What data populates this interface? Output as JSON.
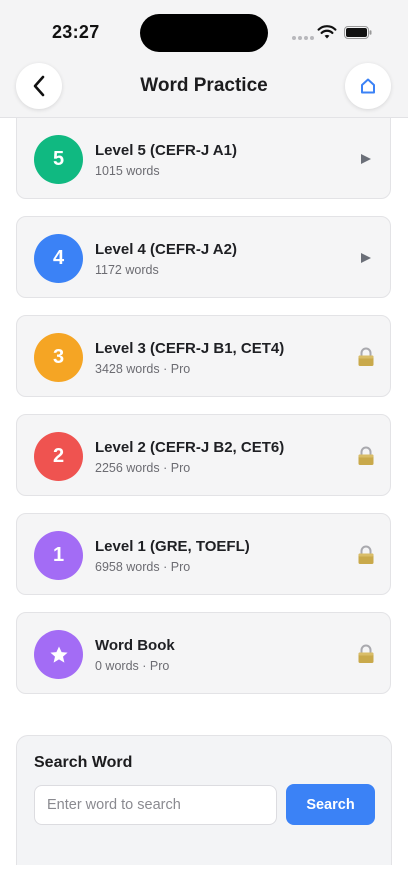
{
  "status_bar": {
    "time": "23:27"
  },
  "header": {
    "title": "Word Practice",
    "back_icon": "chevron-left-icon",
    "home_icon": "home-icon"
  },
  "colors": {
    "accent": "#3b82f6",
    "level5": "#10b981",
    "level4": "#3b82f6",
    "level3": "#f5a524",
    "level2": "#ef5350",
    "level1": "#a36cf5",
    "wordbook": "#a36cf5"
  },
  "levels": [
    {
      "badge": "5",
      "title": "Level 5 (CEFR-J A1)",
      "subtitle": "1015 words",
      "action_icon": "play-icon",
      "locked": false
    },
    {
      "badge": "4",
      "title": "Level 4 (CEFR-J A2)",
      "subtitle": "1172 words",
      "action_icon": "play-icon",
      "locked": false
    },
    {
      "badge": "3",
      "title": "Level 3 (CEFR-J B1, CET4)",
      "subtitle": "3428 words · Pro",
      "action_icon": "lock-icon",
      "locked": true
    },
    {
      "badge": "2",
      "title": "Level 2 (CEFR-J B2, CET6)",
      "subtitle": "2256 words · Pro",
      "action_icon": "lock-icon",
      "locked": true
    },
    {
      "badge": "1",
      "title": "Level 1 (GRE, TOEFL)",
      "subtitle": "6958 words · Pro",
      "action_icon": "lock-icon",
      "locked": true
    },
    {
      "badge_icon": "star-icon",
      "title": "Word Book",
      "subtitle": "0 words · Pro",
      "action_icon": "lock-icon",
      "locked": true
    }
  ],
  "search": {
    "title": "Search Word",
    "placeholder": "Enter word to search",
    "value": "",
    "button_label": "Search"
  }
}
